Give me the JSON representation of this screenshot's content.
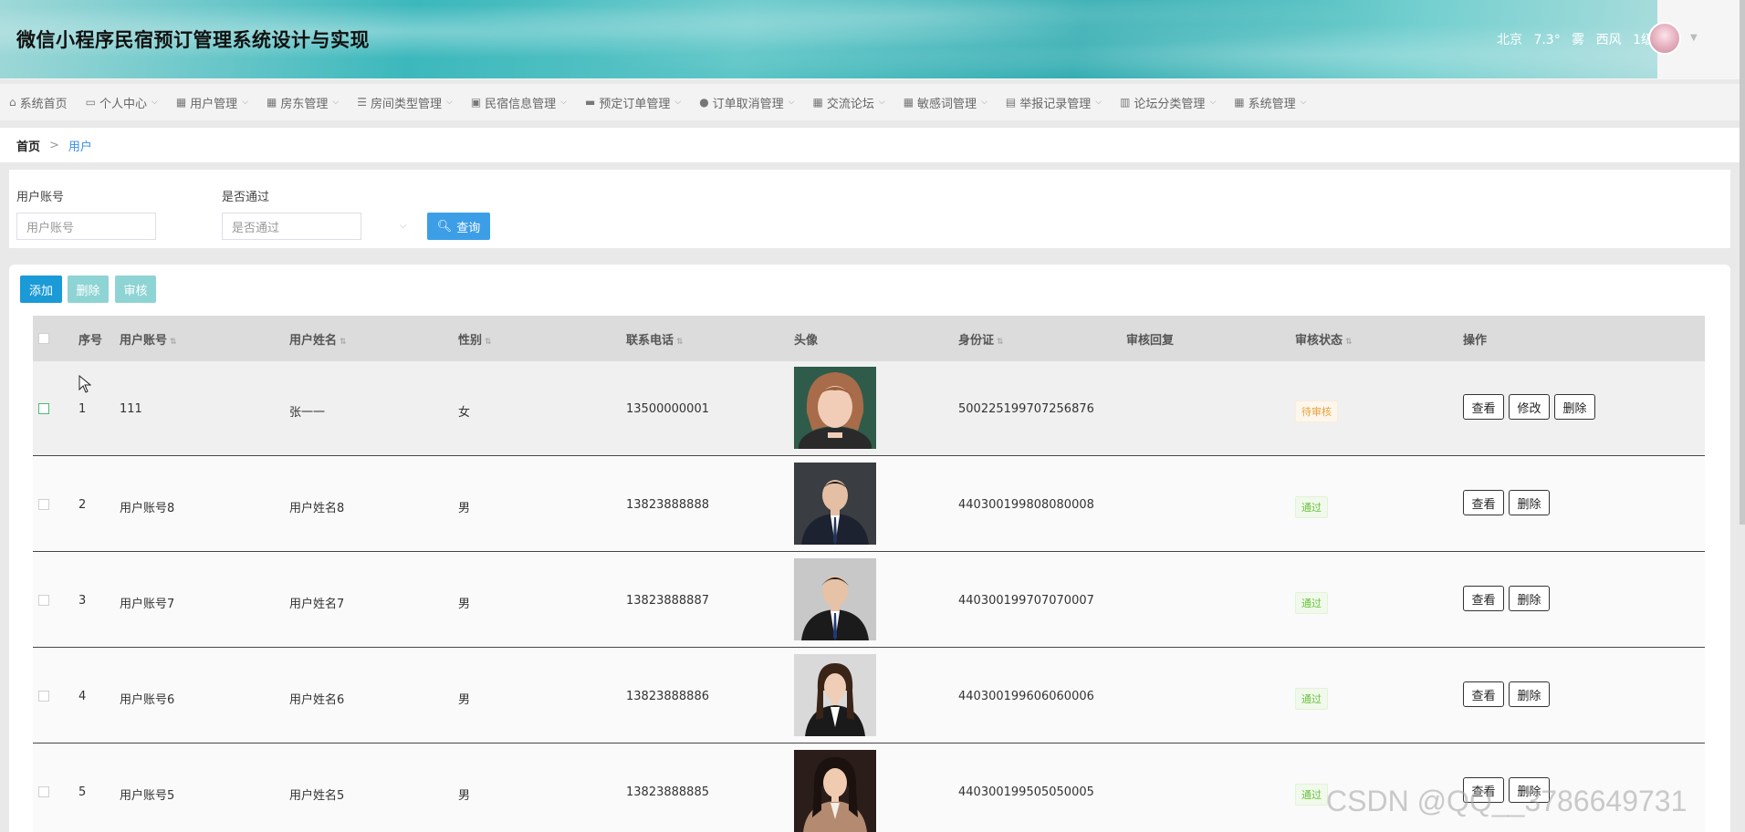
{
  "header": {
    "title": "微信小程序民宿预订管理系统设计与实现",
    "weather": {
      "city": "北京",
      "temp": "7.3°",
      "condition": "雾",
      "wind": "西风",
      "level": "1级"
    }
  },
  "nav": [
    {
      "label": "系统首页",
      "icon": "home-icon",
      "glyph": "⌂",
      "dropdown": false
    },
    {
      "label": "个人中心",
      "icon": "id-card-icon",
      "glyph": "▭",
      "dropdown": true
    },
    {
      "label": "用户管理",
      "icon": "grid-icon",
      "glyph": "▦",
      "dropdown": true
    },
    {
      "label": "房东管理",
      "icon": "grid-icon",
      "glyph": "▦",
      "dropdown": true
    },
    {
      "label": "房间类型管理",
      "icon": "list-icon",
      "glyph": "☰",
      "dropdown": true
    },
    {
      "label": "民宿信息管理",
      "icon": "picture-icon",
      "glyph": "▣",
      "dropdown": true
    },
    {
      "label": "预定订单管理",
      "icon": "monitor-icon",
      "glyph": "▬",
      "dropdown": true
    },
    {
      "label": "订单取消管理",
      "icon": "user-icon",
      "glyph": "●",
      "dropdown": true
    },
    {
      "label": "交流论坛",
      "icon": "grid-icon",
      "glyph": "▦",
      "dropdown": true
    },
    {
      "label": "敏感词管理",
      "icon": "grid-icon",
      "glyph": "▦",
      "dropdown": true
    },
    {
      "label": "举报记录管理",
      "icon": "clipboard-icon",
      "glyph": "▤",
      "dropdown": true
    },
    {
      "label": "论坛分类管理",
      "icon": "bar-chart-icon",
      "glyph": "▥",
      "dropdown": true
    },
    {
      "label": "系统管理",
      "icon": "grid-icon",
      "glyph": "▦",
      "dropdown": true
    }
  ],
  "breadcrumb": {
    "home": "首页",
    "separator": ">",
    "current": "用户"
  },
  "search": {
    "account_label": "用户账号",
    "account_placeholder": "用户账号",
    "approved_label": "是否通过",
    "approved_placeholder": "是否通过",
    "query_label": "查询"
  },
  "actions": {
    "add": "添加",
    "delete": "删除",
    "audit": "审核"
  },
  "table": {
    "columns": {
      "index": "序号",
      "account": "用户账号",
      "name": "用户姓名",
      "gender": "性别",
      "phone": "联系电话",
      "avatar": "头像",
      "id_card": "身份证",
      "audit_reply": "审核回复",
      "audit_status": "审核状态",
      "operation": "操作"
    },
    "rows": [
      {
        "index": "1",
        "account": "111",
        "name": "张一一",
        "gender": "女",
        "phone": "13500000001",
        "id_card": "500225199707256876",
        "audit_reply": "",
        "status": "待审核",
        "status_type": "pending",
        "ops": [
          "查看",
          "修改",
          "删除"
        ]
      },
      {
        "index": "2",
        "account": "用户账号8",
        "name": "用户姓名8",
        "gender": "男",
        "phone": "13823888888",
        "id_card": "440300199808080008",
        "audit_reply": "",
        "status": "通过",
        "status_type": "pass",
        "ops": [
          "查看",
          "删除"
        ]
      },
      {
        "index": "3",
        "account": "用户账号7",
        "name": "用户姓名7",
        "gender": "男",
        "phone": "13823888887",
        "id_card": "440300199707070007",
        "audit_reply": "",
        "status": "通过",
        "status_type": "pass",
        "ops": [
          "查看",
          "删除"
        ]
      },
      {
        "index": "4",
        "account": "用户账号6",
        "name": "用户姓名6",
        "gender": "男",
        "phone": "13823888886",
        "id_card": "440300199606060006",
        "audit_reply": "",
        "status": "通过",
        "status_type": "pass",
        "ops": [
          "查看",
          "删除"
        ]
      },
      {
        "index": "5",
        "account": "用户账号5",
        "name": "用户姓名5",
        "gender": "男",
        "phone": "13823888885",
        "id_card": "440300199505050005",
        "audit_reply": "",
        "status": "通过",
        "status_type": "pass",
        "ops": [
          "查看",
          "删除"
        ]
      }
    ]
  },
  "watermark": "CSDN @QQ__3786649731",
  "colors": {
    "primary": "#1a9ad6",
    "query": "#3d9ee8",
    "muted_btn": "#8fd4d4",
    "pending": "#e6a23c",
    "pass": "#67c23a",
    "link": "#3a8ee6"
  }
}
